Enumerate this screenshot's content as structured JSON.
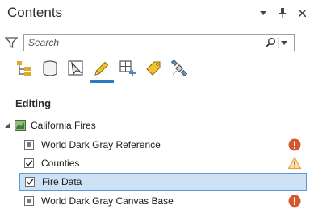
{
  "pane": {
    "title": "Contents",
    "controls": [
      "dropdown",
      "pin",
      "close"
    ]
  },
  "search": {
    "placeholder": "Search",
    "icon": "search-icon"
  },
  "views": [
    {
      "name": "list-by-drawing-order",
      "icon": "drawing-order-icon"
    },
    {
      "name": "list-by-data-source",
      "icon": "data-source-icon"
    },
    {
      "name": "list-by-selection",
      "icon": "selection-icon"
    },
    {
      "name": "list-by-editing",
      "icon": "pencil-icon",
      "active": true
    },
    {
      "name": "list-by-snapping",
      "icon": "snapping-icon"
    },
    {
      "name": "list-by-labeling",
      "icon": "label-tag-icon"
    },
    {
      "name": "list-by-perspective-imagery",
      "icon": "satellite-icon"
    }
  ],
  "section": {
    "title": "Editing"
  },
  "map": {
    "label": "California Fires",
    "expanded": true
  },
  "layers": [
    {
      "label": "World Dark Gray Reference",
      "check": "indeterminate",
      "status": "error",
      "selected": false
    },
    {
      "label": "Counties",
      "check": "checked",
      "status": "warning",
      "selected": false
    },
    {
      "label": "Fire Data",
      "check": "checked",
      "status": "none",
      "selected": true
    },
    {
      "label": "World Dark Gray Canvas Base",
      "check": "indeterminate",
      "status": "error",
      "selected": false
    }
  ],
  "colors": {
    "accent": "#2c7ac4",
    "selection_fill": "#cde3f5",
    "selection_border": "#5d9ad6",
    "error": "#d4582b",
    "warning": "#e8a33b"
  }
}
